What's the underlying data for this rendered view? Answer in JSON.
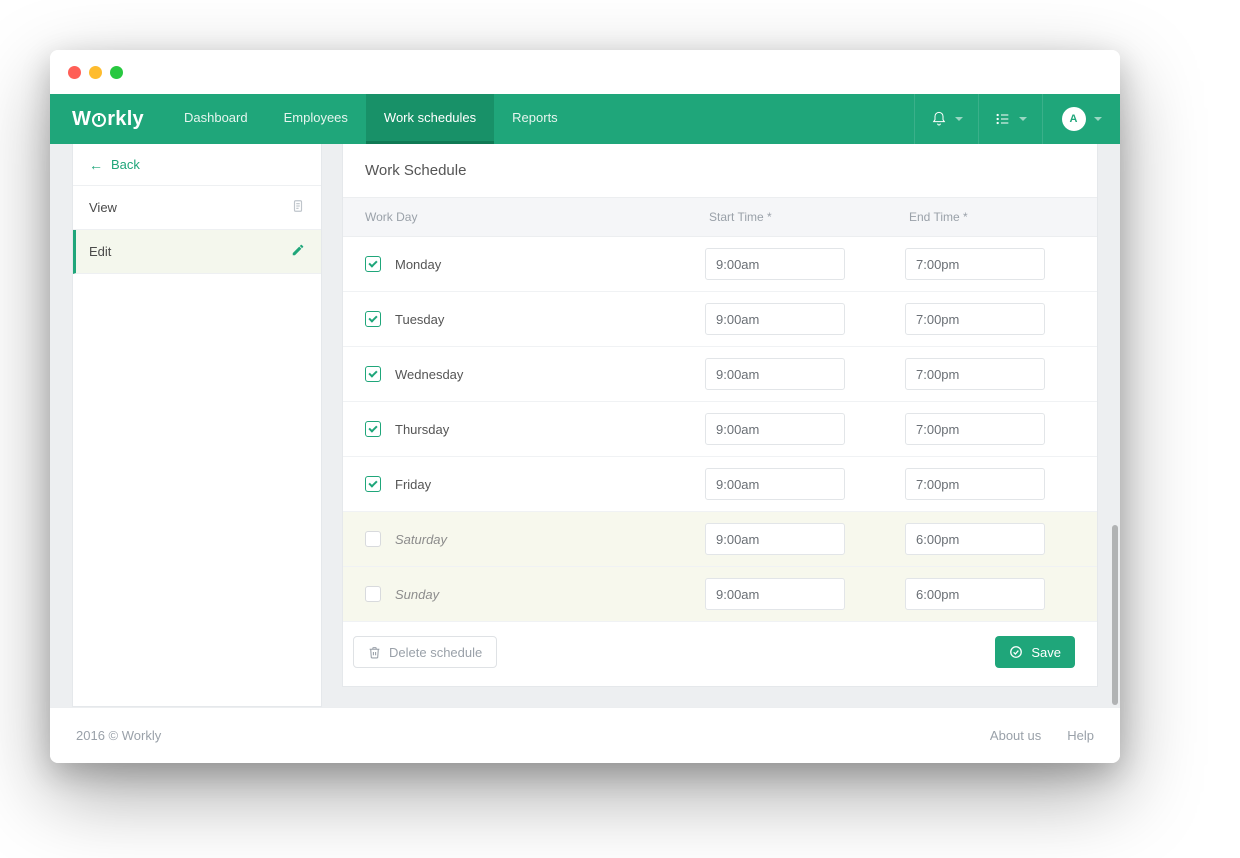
{
  "brand": {
    "prefix": "W",
    "suffix": "rkly"
  },
  "nav": {
    "items": [
      {
        "id": "dashboard",
        "label": "Dashboard",
        "active": false
      },
      {
        "id": "employees",
        "label": "Employees",
        "active": false
      },
      {
        "id": "work-schedules",
        "label": "Work schedules",
        "active": true
      },
      {
        "id": "reports",
        "label": "Reports",
        "active": false
      }
    ],
    "avatar_initial": "A"
  },
  "sidebar": {
    "back_label": "Back",
    "view_label": "View",
    "edit_label": "Edit"
  },
  "panel": {
    "title": "Work Schedule",
    "col_day": "Work Day",
    "col_start": "Start Time *",
    "col_end": "End Time *"
  },
  "days": [
    {
      "id": "mon",
      "label": "Monday",
      "checked": true,
      "start": "9:00am",
      "end": "7:00pm"
    },
    {
      "id": "tue",
      "label": "Tuesday",
      "checked": true,
      "start": "9:00am",
      "end": "7:00pm"
    },
    {
      "id": "wed",
      "label": "Wednesday",
      "checked": true,
      "start": "9:00am",
      "end": "7:00pm"
    },
    {
      "id": "thu",
      "label": "Thursday",
      "checked": true,
      "start": "9:00am",
      "end": "7:00pm"
    },
    {
      "id": "fri",
      "label": "Friday",
      "checked": true,
      "start": "9:00am",
      "end": "7:00pm"
    },
    {
      "id": "sat",
      "label": "Saturday",
      "checked": false,
      "start": "9:00am",
      "end": "6:00pm"
    },
    {
      "id": "sun",
      "label": "Sunday",
      "checked": false,
      "start": "9:00am",
      "end": "6:00pm"
    }
  ],
  "actions": {
    "delete_label": "Delete schedule",
    "save_label": "Save"
  },
  "footer": {
    "copyright": "2016 © Workly",
    "about": "About us",
    "help": "Help"
  }
}
